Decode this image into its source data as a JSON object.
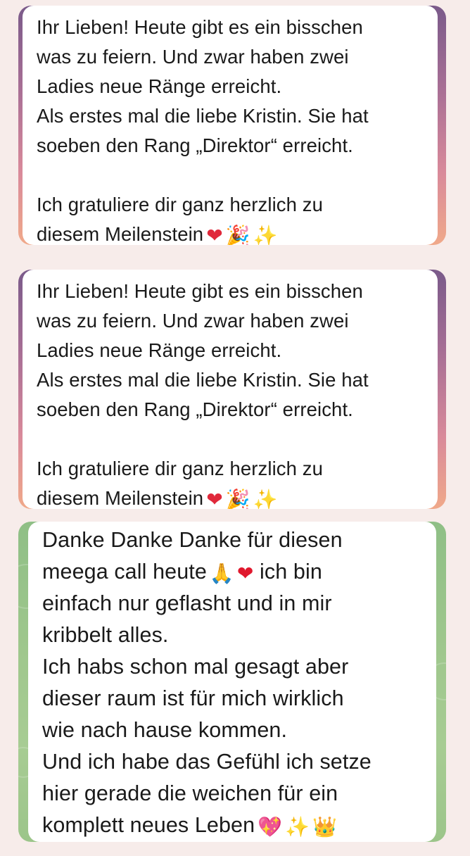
{
  "messages": [
    {
      "text": "Ihr Lieben! Heute gibt es ein bisschen\nwas zu feiern. Und zwar haben zwei\nLadies neue Ränge erreicht.\nAls erstes mal die liebe Kristin. Sie hat\nsoeben den Rang „Direktor“ erreicht.\n\nIch gratuliere dir ganz herzlich zu\ndiesem Meilenstein",
      "emojis": [
        "❤",
        "🎉",
        "✨"
      ],
      "emoji_names": [
        "heart-on-fire-icon",
        "party-popper-icon",
        "sparkles-icon"
      ]
    },
    {
      "text": "Ihr Lieben! Heute gibt es ein bisschen\nwas zu feiern. Und zwar haben zwei\nLadies neue Ränge erreicht.\nAls erstes mal die liebe Kristin. Sie hat\nsoeben den Rang „Direktor“ erreicht.\n\nIch gratuliere dir ganz herzlich zu\ndiesem Meilenstein",
      "emojis": [
        "❤",
        "🎉",
        "✨"
      ],
      "emoji_names": [
        "heart-on-fire-icon",
        "party-popper-icon",
        "sparkles-icon"
      ]
    },
    {
      "text_part1": "Danke Danke Danke für diesen\nmeega call heute",
      "inline_emojis": [
        "🙏",
        "❤"
      ],
      "text_part2": "ich bin\neinfach nur geflasht und in mir\nkribbelt alles.\nIch habs schon mal gesagt aber\ndieser raum ist für mich wirklich\nwie nach hause kommen.\nUnd ich habe das Gefühl ich setze\nhier gerade die weichen für ein\nkomplett neues Leben",
      "emojis": [
        "💖",
        "✨",
        "👑"
      ],
      "emoji_names": [
        "sparkling-heart-icon",
        "sparkles-icon",
        "crown-icon"
      ]
    }
  ],
  "colors": {
    "background": "#f7ecea",
    "bubble": "#ffffff",
    "text": "#1a1a1a",
    "chat_bg_pink_top": "#7a5a8a",
    "chat_bg_pink_bottom": "#f0a98a",
    "chat_bg_green": "#9fc78d"
  }
}
